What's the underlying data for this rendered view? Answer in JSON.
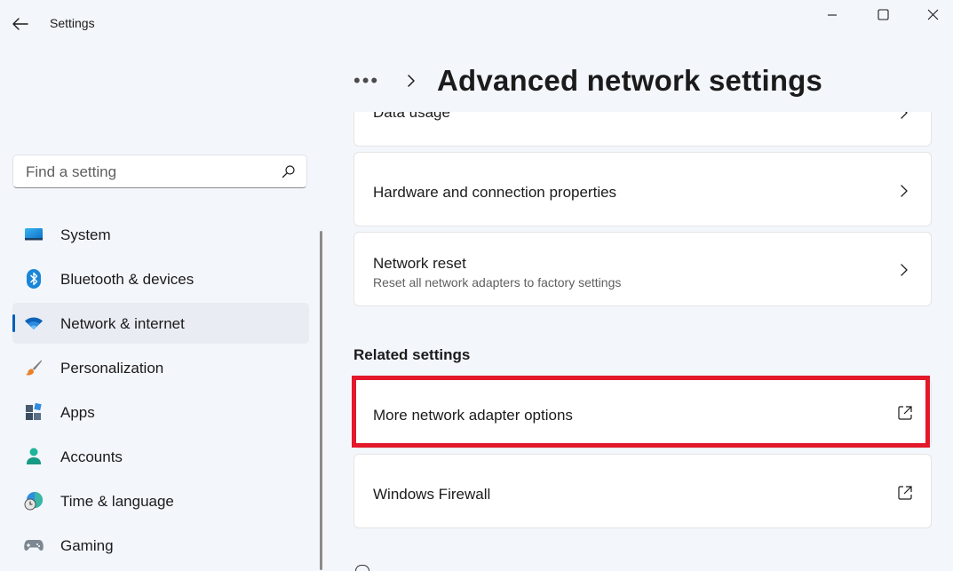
{
  "window": {
    "title": "Settings"
  },
  "search": {
    "placeholder": "Find a setting"
  },
  "sidebar": {
    "items": [
      {
        "label": "System",
        "icon": "monitor-icon",
        "active": false
      },
      {
        "label": "Bluetooth & devices",
        "icon": "bluetooth-icon",
        "active": false
      },
      {
        "label": "Network & internet",
        "icon": "wifi-icon",
        "active": true
      },
      {
        "label": "Personalization",
        "icon": "paintbrush-icon",
        "active": false
      },
      {
        "label": "Apps",
        "icon": "apps-icon",
        "active": false
      },
      {
        "label": "Accounts",
        "icon": "person-icon",
        "active": false
      },
      {
        "label": "Time & language",
        "icon": "globe-clock-icon",
        "active": false
      },
      {
        "label": "Gaming",
        "icon": "gamepad-icon",
        "active": false
      }
    ]
  },
  "breadcrumb": {
    "more": "•••",
    "title": "Advanced network settings"
  },
  "cards": {
    "data_usage": {
      "title": "Data usage"
    },
    "hardware": {
      "title": "Hardware and connection properties"
    },
    "network_reset": {
      "title": "Network reset",
      "subtitle": "Reset all network adapters to factory settings"
    }
  },
  "related": {
    "heading": "Related settings",
    "items": [
      {
        "title": "More network adapter options"
      },
      {
        "title": "Windows Firewall"
      }
    ]
  },
  "colors": {
    "accent": "#005fb8",
    "highlight": "#e3182b",
    "background": "#f3f6fb"
  }
}
